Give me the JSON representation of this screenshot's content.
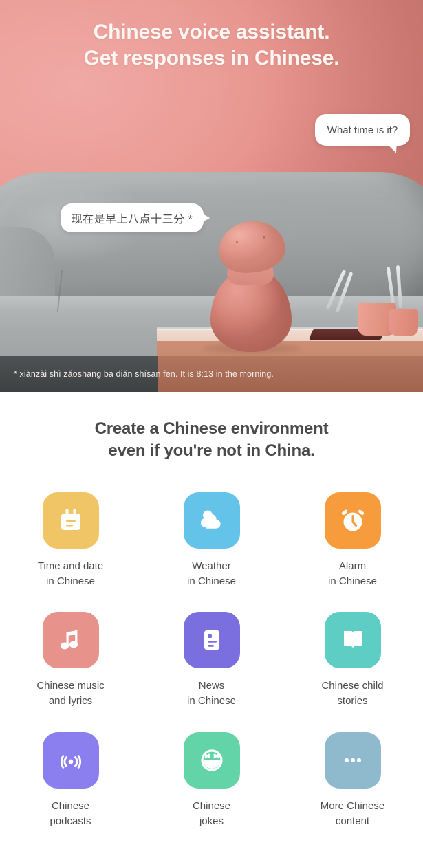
{
  "hero": {
    "headline_line1": "Chinese voice assistant.",
    "headline_line2": "Get responses in Chinese.",
    "bubble_question": "What time is it?",
    "bubble_answer": "现在是早上八点十三分 *",
    "caption": "* xiànzài shì zǎoshang bā diǎn shísān fēn. It is 8:13 in the morning.",
    "colors": {
      "wall_light": "#f0a9a6",
      "wall_dark": "#c0706a",
      "caption_left_bg": "#454849",
      "caption_right_bg": "#a8654f",
      "bubble_bg": "#ffffff",
      "headline_color": "#fdf6f2"
    }
  },
  "features": {
    "title_line1": "Create a Chinese environment",
    "title_line2": "even if you're not in China.",
    "items": [
      {
        "icon": "calendar-notepad-icon",
        "color": "#efc565",
        "label_line1": "Time and date",
        "label_line2": "in Chinese"
      },
      {
        "icon": "cloud-sun-icon",
        "color": "#63c3e8",
        "label_line1": "Weather",
        "label_line2": "in Chinese"
      },
      {
        "icon": "alarm-clock-icon",
        "color": "#f69c3c",
        "label_line1": "Alarm",
        "label_line2": "in Chinese"
      },
      {
        "icon": "music-note-icon",
        "color": "#e8928c",
        "label_line1": "Chinese music",
        "label_line2": "and lyrics"
      },
      {
        "icon": "news-document-icon",
        "color": "#7b6fe0",
        "label_line1": "News",
        "label_line2": "in Chinese"
      },
      {
        "icon": "open-book-icon",
        "color": "#5ecdc4",
        "label_line1": "Chinese child",
        "label_line2": "stories"
      },
      {
        "icon": "podcast-broadcast-icon",
        "color": "#8b7ff0",
        "label_line1": "Chinese",
        "label_line2": "podcasts"
      },
      {
        "icon": "laughing-face-icon",
        "color": "#63d4a8",
        "label_line1": "Chinese",
        "label_line2": "jokes"
      },
      {
        "icon": "ellipsis-more-icon",
        "color": "#8fb9cd",
        "label_line1": "More Chinese",
        "label_line2": "content"
      }
    ]
  }
}
